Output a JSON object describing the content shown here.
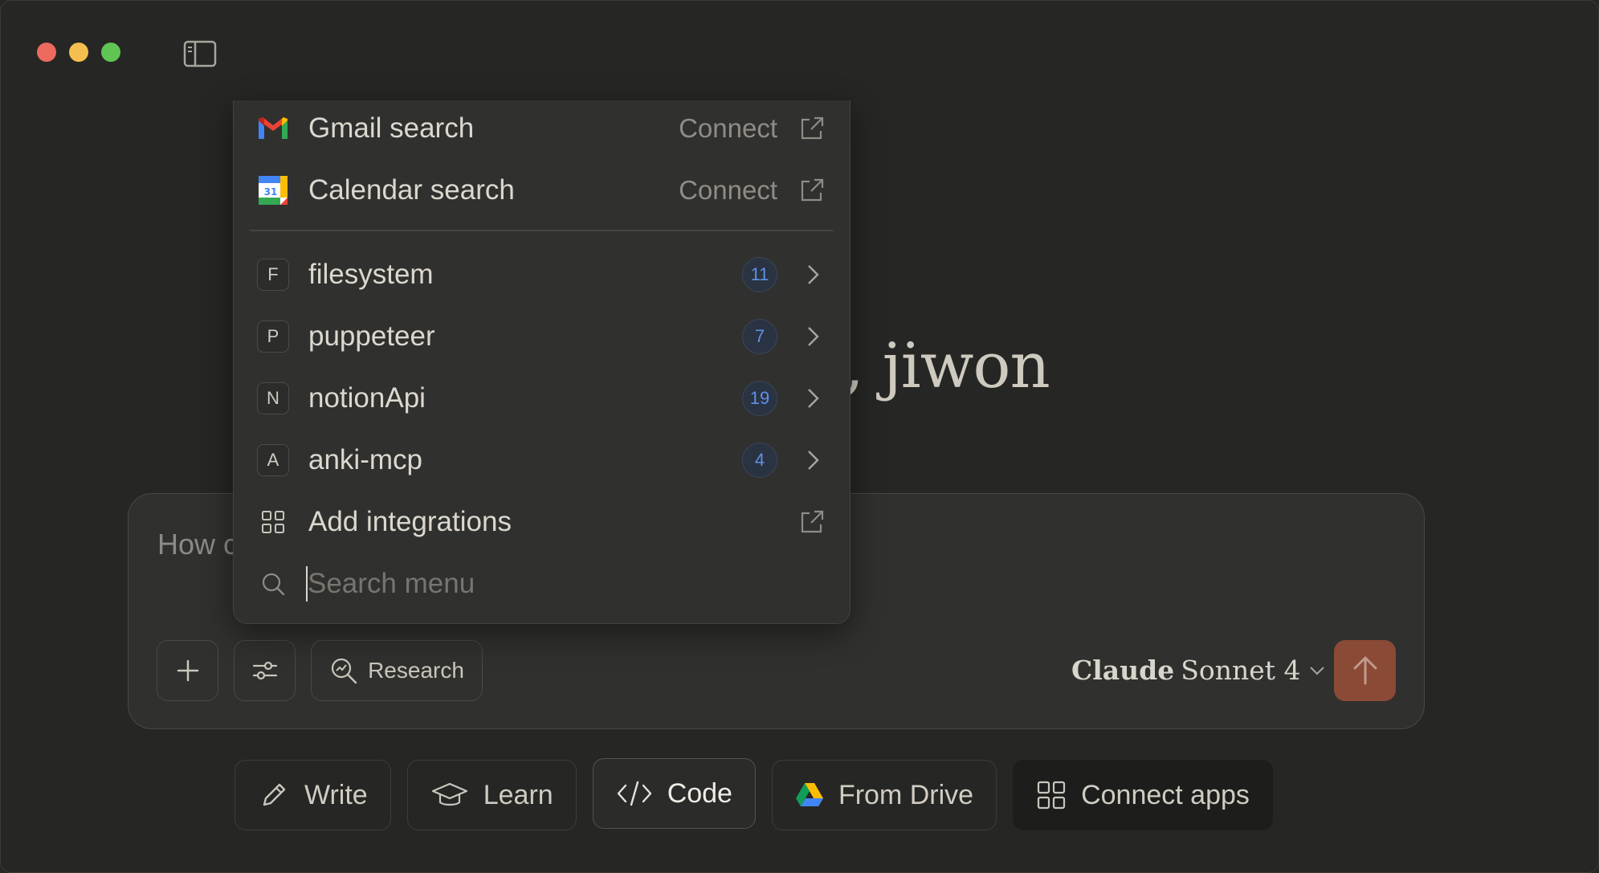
{
  "window": {
    "traffic_lights": [
      "close",
      "minimize",
      "maximize"
    ]
  },
  "greeting": {
    "text": ", jiwon"
  },
  "composer": {
    "input_placeholder": "How c",
    "research_label": "Research",
    "model": {
      "brand": "Claude",
      "name": "Sonnet 4"
    },
    "send_color": "#8b4a36"
  },
  "chips": [
    {
      "label": "Write",
      "icon": "pencil-icon"
    },
    {
      "label": "Learn",
      "icon": "graduation-cap-icon"
    },
    {
      "label": "Code",
      "icon": "code-icon"
    },
    {
      "label": "From Drive",
      "icon": "google-drive-icon"
    },
    {
      "label": "Connect apps",
      "icon": "grid-icon"
    }
  ],
  "menu": {
    "connectors": [
      {
        "label": "Gmail search",
        "action": "Connect",
        "icon": "gmail-icon"
      },
      {
        "label": "Calendar search",
        "action": "Connect",
        "icon": "google-calendar-icon"
      }
    ],
    "integrations": [
      {
        "letter": "F",
        "label": "filesystem",
        "count": "11"
      },
      {
        "letter": "P",
        "label": "puppeteer",
        "count": "7"
      },
      {
        "letter": "N",
        "label": "notionApi",
        "count": "19"
      },
      {
        "letter": "A",
        "label": "anki-mcp",
        "count": "4"
      }
    ],
    "add_integrations": "Add integrations",
    "search_placeholder": "Search menu",
    "calendar_day": "31",
    "badge_color": "#5f90e6"
  }
}
